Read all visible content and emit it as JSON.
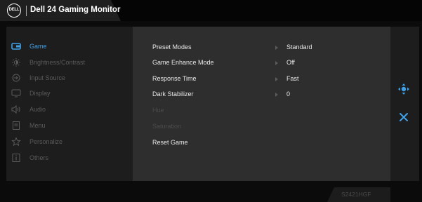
{
  "header": {
    "logo_text": "DELL",
    "title": "Dell 24 Gaming Monitor"
  },
  "menu": {
    "items": [
      {
        "label": "Game",
        "icon": "game-controller-icon",
        "active": true
      },
      {
        "label": "Brightness/Contrast",
        "icon": "brightness-icon",
        "active": false
      },
      {
        "label": "Input Source",
        "icon": "input-source-icon",
        "active": false
      },
      {
        "label": "Display",
        "icon": "display-icon",
        "active": false
      },
      {
        "label": "Audio",
        "icon": "audio-icon",
        "active": false
      },
      {
        "label": "Menu",
        "icon": "menu-icon",
        "active": false
      },
      {
        "label": "Personalize",
        "icon": "star-icon",
        "active": false
      },
      {
        "label": "Others",
        "icon": "info-icon",
        "active": false
      }
    ]
  },
  "options": [
    {
      "label": "Preset Modes",
      "value": "Standard",
      "enabled": true
    },
    {
      "label": "Game Enhance Mode",
      "value": "Off",
      "enabled": true
    },
    {
      "label": "Response Time",
      "value": "Fast",
      "enabled": true
    },
    {
      "label": "Dark Stabilizer",
      "value": "0",
      "enabled": true
    },
    {
      "label": "Hue",
      "value": "",
      "enabled": false
    },
    {
      "label": "Saturation",
      "value": "",
      "enabled": false
    },
    {
      "label": "Reset Game",
      "value": "",
      "enabled": true
    }
  ],
  "side_controls": {
    "move_icon": "move-arrows-icon",
    "close_icon": "close-icon"
  },
  "footer": {
    "model": "S2421HGF"
  },
  "colors": {
    "accent": "#3fa0e8"
  }
}
